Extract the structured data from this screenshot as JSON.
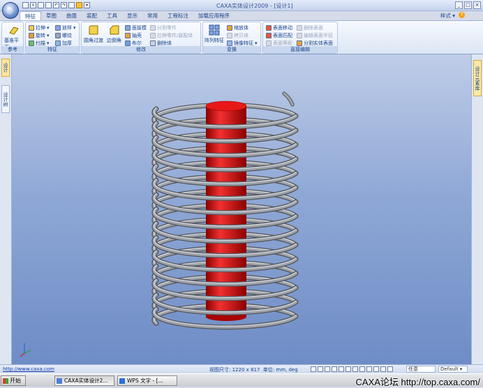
{
  "window": {
    "title": "CAXA实体设计2009 - [设计1]"
  },
  "ribbon_tabs": [
    "特征",
    "草图",
    "曲面",
    "装配",
    "工具",
    "显示",
    "常用",
    "工程标注",
    "加载应用程序"
  ],
  "style_menu": "样式",
  "groups": {
    "reference": {
      "label": "参考",
      "big": "基准平面"
    },
    "feature": {
      "label": "特征",
      "items": [
        "拉伸",
        "放样",
        "旋转",
        "螺纹",
        "扫描",
        "加厚"
      ]
    },
    "modify": {
      "label": "修改",
      "big1": "圆角过渡",
      "big2": "边倒角",
      "items": [
        "面拔模",
        "抽壳",
        "布尔",
        "分割零件",
        "拉伸零件/装配体",
        "删除体"
      ]
    },
    "transform": {
      "label": "变换",
      "big": "阵列特征",
      "items": [
        "缩放体",
        "拷贝体",
        "镜像特征"
      ]
    },
    "direct_edit": {
      "label": "直接编辑",
      "items": [
        "表面移动",
        "表面匹配",
        "表面等距",
        "删除表面",
        "编辑表面半径",
        "分割实体表面"
      ]
    }
  },
  "left_panel_tabs": [
    "设计",
    "设计树"
  ],
  "right_panel_tabs": [
    "设计元素库"
  ],
  "status": {
    "url": "http://www.caxa.com",
    "view_size": "视图尺寸: 1220 x 817",
    "units": "单位: mm, deg",
    "dropdown1": "任意",
    "dropdown2": "Default"
  },
  "taskbar": {
    "start": "开始",
    "tasks": [
      "CAXA实体设计2...",
      "WPS 文字 - [..."
    ]
  },
  "watermark": "CAXA论坛 http://top.caxa.com/",
  "colors": {
    "cylinder": "#e01010",
    "spring": "#8c9096",
    "viewport_top": "#bfcde8",
    "viewport_bottom": "#6e8cc6"
  }
}
